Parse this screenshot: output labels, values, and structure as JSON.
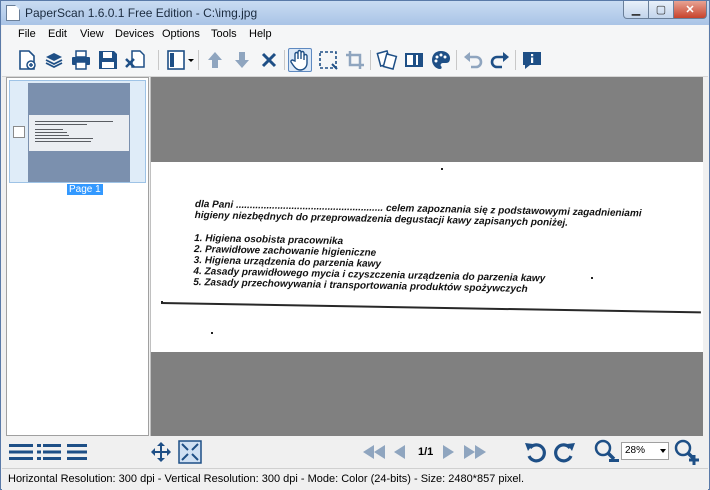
{
  "window": {
    "title": "PaperScan 1.6.0.1 Free Edition - C:\\img.jpg"
  },
  "menu": [
    "File",
    "Edit",
    "View",
    "Devices",
    "Options",
    "Tools",
    "Help"
  ],
  "toolbar": {
    "icons": [
      "new-document-icon",
      "import-stack-icon",
      "print-icon",
      "save-icon",
      "delete-pages-icon",
      "page-layout-icon",
      "move-up-icon",
      "move-down-icon",
      "remove-icon",
      "hand-tool-icon",
      "selection-icon",
      "crop-icon",
      "rotate-pages-icon",
      "filter-icon",
      "color-palette-icon",
      "undo-icon",
      "redo-icon",
      "info-icon"
    ]
  },
  "thumbnails": [
    {
      "label": "Page 1"
    }
  ],
  "document": {
    "lines": [
      "dla Pani ..................................................... celem zapoznania się z podstawowymi  zagadnieniami",
      "higieny niezbędnych do przeprowadzenia degustacji kawy zapisanych poniżej.",
      "",
      "1. Higiena osobista pracownika",
      "2. Prawidłowe zachowanie higieniczne",
      "3. Higiena urządzenia do parzenia kawy",
      "4. Zasady prawidłowego mycia i czyszczenia urządzenia do parzenia kawy",
      "5. Zasady przechowywania i transportowania produktów spożywczych"
    ]
  },
  "navigation": {
    "page_counter": "1/1"
  },
  "zoom": {
    "value": "28%"
  },
  "status": {
    "text": "Horizontal Resolution:  300 dpi - Vertical Resolution:  300 dpi - Mode: Color (24-bits) - Size: 2480*857 pixel."
  },
  "colors": {
    "accent": "#3399ff",
    "icon_blue": "#1e4f86",
    "viewer_bg": "#808080"
  }
}
